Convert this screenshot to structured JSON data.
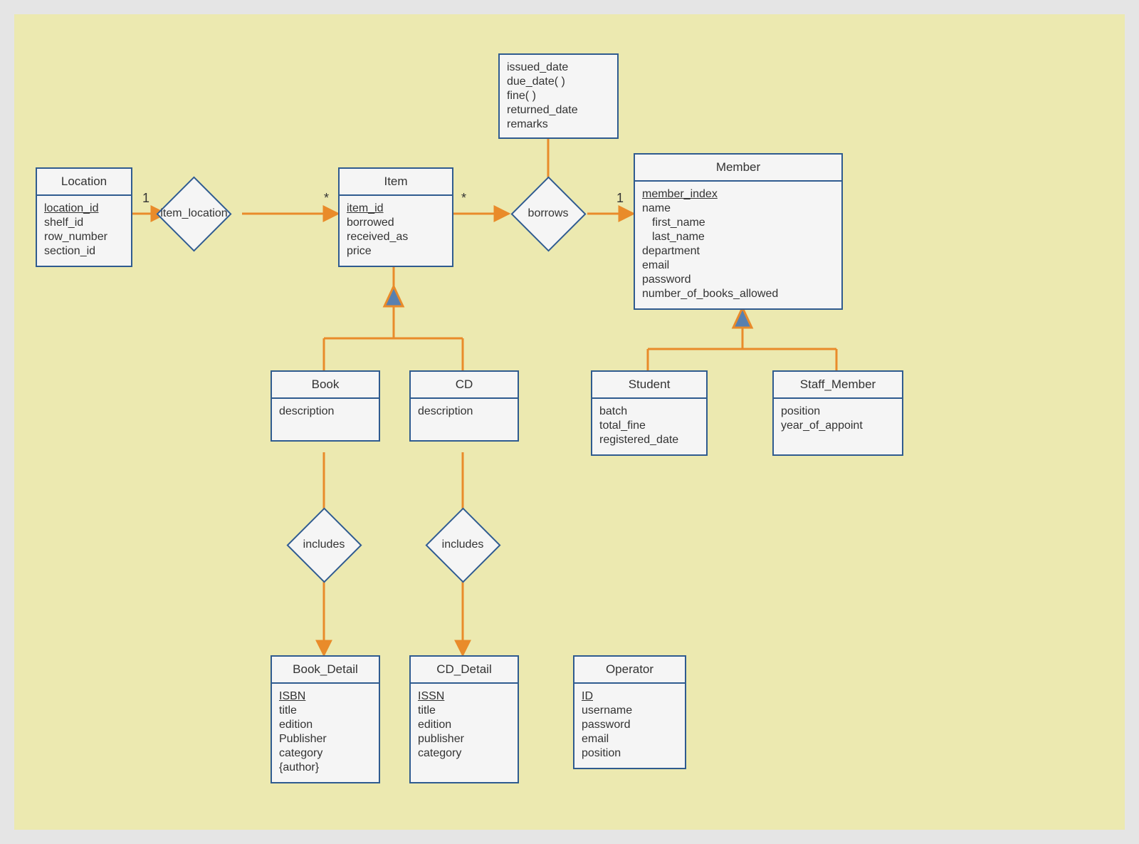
{
  "diagram_type": "Entity-Relationship Diagram",
  "entities": {
    "location": {
      "title": "Location",
      "attrs": [
        "location_id",
        "shelf_id",
        "row_number",
        "section_id"
      ],
      "key": "location_id"
    },
    "item": {
      "title": "Item",
      "attrs": [
        "item_id",
        "borrowed",
        "received_as",
        "price"
      ],
      "key": "item_id"
    },
    "member": {
      "title": "Member",
      "attrs": [
        "member_index",
        "name",
        "first_name",
        "last_name",
        "department",
        "email",
        "password",
        "number_of_books_allowed"
      ],
      "key": "member_index",
      "nested": {
        "name": [
          "first_name",
          "last_name"
        ]
      }
    },
    "book": {
      "title": "Book",
      "attrs": [
        "description"
      ]
    },
    "cd": {
      "title": "CD",
      "attrs": [
        "description"
      ]
    },
    "student": {
      "title": "Student",
      "attrs": [
        "batch",
        "total_fine",
        "registered_date"
      ]
    },
    "staff_member": {
      "title": "Staff_Member",
      "attrs": [
        "position",
        "year_of_appoint"
      ]
    },
    "book_detail": {
      "title": "Book_Detail",
      "attrs": [
        "ISBN",
        "title",
        "edition",
        "Publisher",
        "category",
        "{author}"
      ],
      "key": "ISBN"
    },
    "cd_detail": {
      "title": "CD_Detail",
      "attrs": [
        "ISSN",
        "title",
        "edition",
        "publisher",
        "category"
      ],
      "key": "ISSN"
    },
    "operator": {
      "title": "Operator",
      "attrs": [
        "ID",
        "username",
        "password",
        "email",
        "position"
      ],
      "key": "ID"
    }
  },
  "relationships": {
    "item_location": {
      "label": "item_location",
      "left_card": "1",
      "right_card": "*"
    },
    "borrows": {
      "label": "borrows",
      "left_card": "*",
      "right_card": "1",
      "attrs": [
        "issued_date",
        "due_date( )",
        "fine( )",
        "returned_date",
        "remarks"
      ]
    },
    "includes_book": {
      "label": "includes"
    },
    "includes_cd": {
      "label": "includes"
    }
  },
  "generalizations": [
    {
      "parent": "Item",
      "children": [
        "Book",
        "CD"
      ]
    },
    {
      "parent": "Member",
      "children": [
        "Student",
        "Staff_Member"
      ]
    }
  ]
}
